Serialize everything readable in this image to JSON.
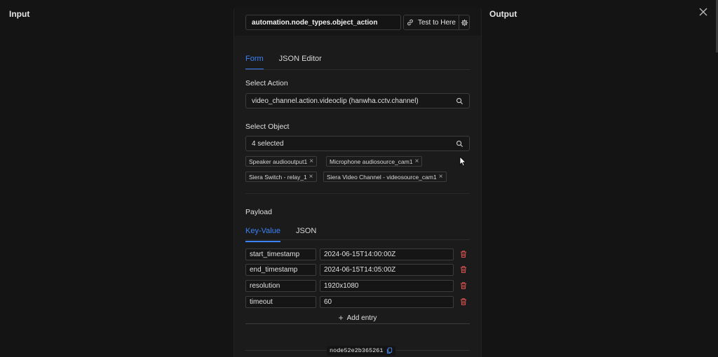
{
  "sides": {
    "input_title": "Input",
    "output_title": "Output"
  },
  "header": {
    "node_type": "automation.node_types.object_action",
    "test_button_label": "Test to Here"
  },
  "editor_tabs": [
    {
      "label": "Form",
      "active": true
    },
    {
      "label": "JSON Editor",
      "active": false
    }
  ],
  "select_action": {
    "label": "Select Action",
    "value": "video_channel.action.videoclip (hanwha.cctv.channel)"
  },
  "select_object": {
    "label": "Select Object",
    "value": "4 selected",
    "chips": [
      "Speaker audiooutput1",
      "Microphone audiosource_cam1",
      "Siera Switch - relay_1",
      "Siera Video Channel - videosource_cam1"
    ]
  },
  "payload": {
    "label": "Payload",
    "tabs": [
      {
        "label": "Key-Value",
        "active": true
      },
      {
        "label": "JSON",
        "active": false
      }
    ],
    "entries": [
      {
        "key": "start_timestamp",
        "value": "2024-06-15T14:00:00Z"
      },
      {
        "key": "end_timestamp",
        "value": "2024-06-15T14:05:00Z"
      },
      {
        "key": "resolution",
        "value": "1920x1080"
      },
      {
        "key": "timeout",
        "value": "60"
      }
    ],
    "add_entry_label": "Add entry"
  },
  "footer": {
    "node_id": "node52e2b365261"
  },
  "colors": {
    "accent": "#3b82f6",
    "danger": "#d9534f",
    "background": "#141414",
    "panel": "#1b1b1b"
  }
}
